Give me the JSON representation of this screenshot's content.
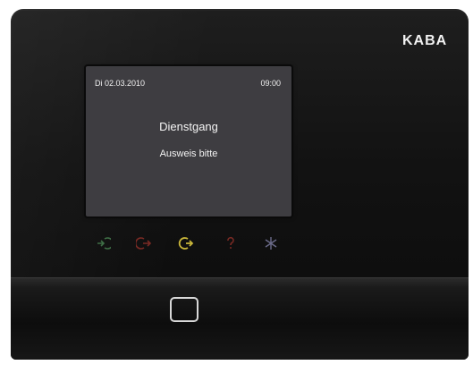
{
  "device": {
    "brand": "KABA"
  },
  "screen": {
    "date": "Di 02.03.2010",
    "time": "09:00",
    "title": "Dienstgang",
    "subtitle": "Ausweis bitte"
  },
  "function_keys": [
    {
      "icon": "arrow-in-icon",
      "color": "#3f6e46"
    },
    {
      "icon": "arrow-out-icon",
      "color": "#7a2a24"
    },
    {
      "icon": "errand-icon",
      "color": "#c9b63a"
    },
    {
      "icon": "question-icon",
      "color": "#7a2a24"
    },
    {
      "icon": "asterisk-icon",
      "color": "#6b6b8a"
    }
  ]
}
